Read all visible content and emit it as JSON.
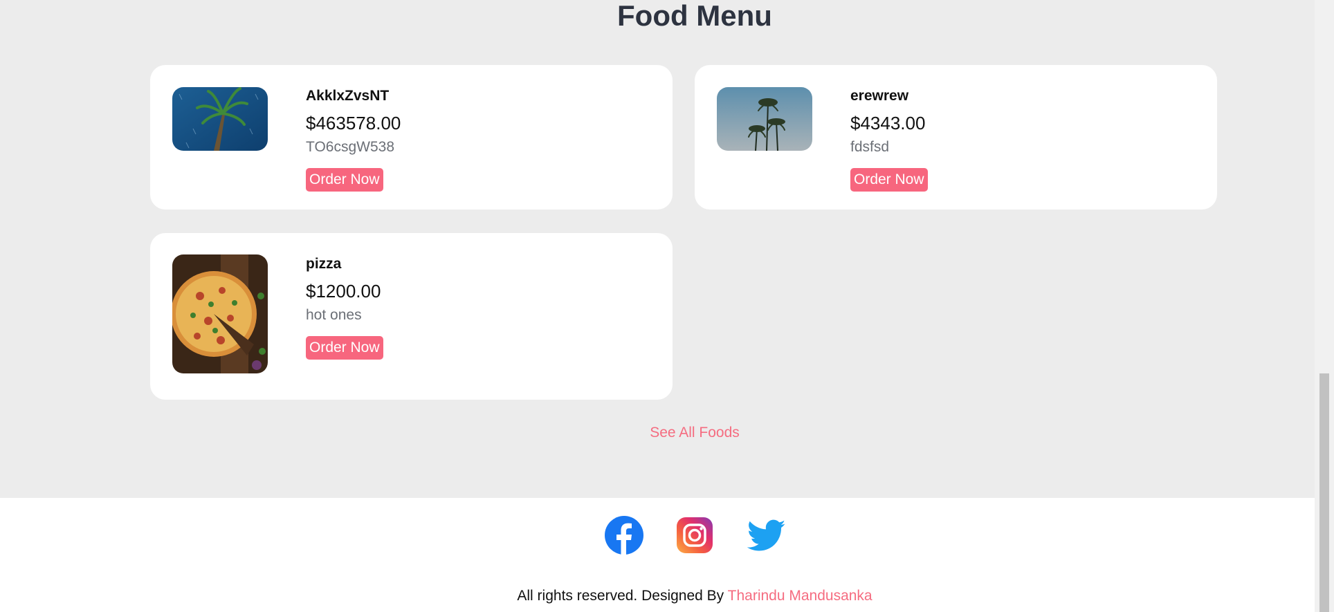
{
  "menu": {
    "title": "Food Menu",
    "items": [
      {
        "name": "AkklxZvsNT",
        "price": "$463578.00",
        "description": "TO6csgW538",
        "order_label": "Order Now",
        "image": "palm-tree-rain-image"
      },
      {
        "name": "erewrew",
        "price": "$4343.00",
        "description": "fdsfsd",
        "order_label": "Order Now",
        "image": "palm-trees-sky-image"
      },
      {
        "name": "pizza",
        "price": "$1200.00",
        "description": "hot ones",
        "order_label": "Order Now",
        "image": "pizza-image"
      }
    ],
    "see_all_label": "See All Foods"
  },
  "footer": {
    "social": [
      "facebook-icon",
      "instagram-icon",
      "twitter-icon"
    ],
    "copyright_prefix": "All rights reserved. Designed By ",
    "author": "Tharindu Mandusanka"
  },
  "colors": {
    "accent": "#f7667e",
    "title": "#2d3340",
    "background": "#ececec"
  }
}
